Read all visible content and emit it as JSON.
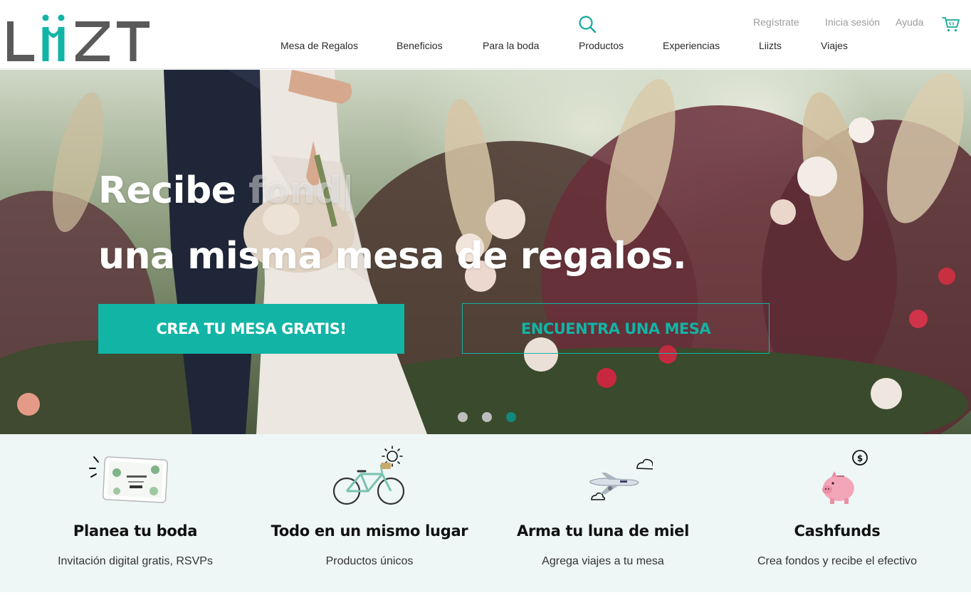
{
  "brand": {
    "logo_text": "LIIZT",
    "accent_color": "#12b4a6",
    "logo_color": "#5a5a5a"
  },
  "header": {
    "icons": {
      "search": "search-icon",
      "cart": "cart-icon"
    },
    "utility_links": {
      "register": "Regístrate",
      "login": "Inicia sesión",
      "help": "Ayuda"
    },
    "nav": {
      "mesa_de_regalos": "Mesa de Regalos",
      "beneficios": "Beneficios",
      "para_la_boda": "Para la boda",
      "productos": "Productos",
      "experiencias": "Experiencias",
      "liizts": "Liizts",
      "viajes": "Viajes"
    }
  },
  "hero": {
    "headline_line1_solid": "Recibe",
    "headline_line1_faded": "fond|",
    "headline_line2": "una misma mesa de regalos.",
    "cta_primary": "CREA TU MESA GRATIS!",
    "cta_secondary": "ENCUENTRA UNA MESA",
    "carousel": {
      "slides": 3,
      "active_slide": 3
    }
  },
  "features": [
    {
      "icon": "tablet-invitation-icon",
      "title": "Planea tu boda",
      "subtitle": "Invitación digital gratis, RSVPs"
    },
    {
      "icon": "bicycle-icon",
      "title": "Todo en un mismo lugar",
      "subtitle": "Productos únicos"
    },
    {
      "icon": "airplane-icon",
      "title": "Arma tu luna de miel",
      "subtitle": "Agrega viajes a tu mesa"
    },
    {
      "icon": "piggy-bank-icon",
      "title": "Cashfunds",
      "subtitle": "Crea fondos y recibe el efectivo"
    }
  ]
}
